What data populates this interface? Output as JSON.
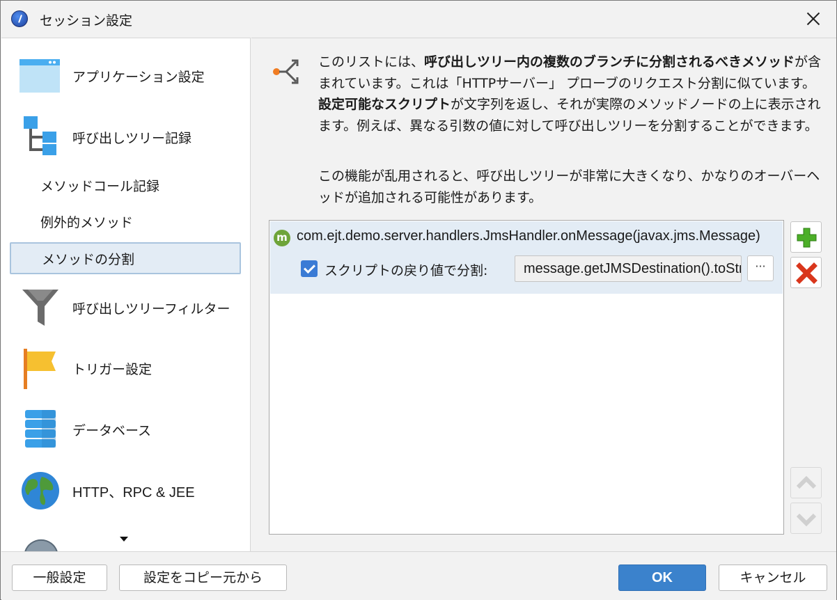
{
  "window": {
    "title": "セッション設定"
  },
  "sidebar": {
    "items": [
      {
        "label": "アプリケーション設定",
        "icon": "application-window-icon"
      },
      {
        "label": "呼び出しツリー記録",
        "icon": "call-tree-icon"
      },
      {
        "label": "メソッドコール記録",
        "icon": ""
      },
      {
        "label": "例外的メソッド",
        "icon": ""
      },
      {
        "label": "メソッドの分割",
        "icon": "",
        "selected": true
      },
      {
        "label": "呼び出しツリーフィルター",
        "icon": "funnel-icon"
      },
      {
        "label": "トリガー設定",
        "icon": "flag-icon"
      },
      {
        "label": "データベース",
        "icon": "database-icon"
      },
      {
        "label": "HTTP、RPC & JEE",
        "icon": "globe-icon"
      }
    ]
  },
  "main": {
    "description": {
      "p1_t1": "このリストには、",
      "p1_b1": "呼び出しツリー内の複数のブランチに分割されるべきメソッド",
      "p1_t2": "が含まれています。これは「HTTPサーバー」 プローブのリクエスト分割に似ています。",
      "p1_b2": "設定可能なスクリプト",
      "p1_t3": "が文字列を返し、それが実際のメソッドノードの上に表示されます。例えば、異なる引数の値に対して呼び出しツリーを分割することができます。",
      "p2": "この機能が乱用されると、呼び出しツリーが非常に大きくなり、かなりのオーバーヘッドが追加される可能性があります。"
    },
    "list": {
      "entries": [
        {
          "badge": "m",
          "method": "com.ejt.demo.server.handlers.JmsHandler.onMessage(javax.jms.Message)",
          "checkbox_label": "スクリプトの戻り値で分割:",
          "checked": true,
          "script_value": "message.getJMSDestination().toString()",
          "ellipsis_label": "···"
        }
      ]
    }
  },
  "footer": {
    "general_settings": "一般設定",
    "copy_settings": "設定をコピー元から",
    "ok": "OK",
    "cancel": "キャンセル"
  },
  "colors": {
    "accent": "#3b82cc",
    "selection": "#e3ecf5",
    "add_green": "#4caf28",
    "remove_red": "#d9361c"
  }
}
